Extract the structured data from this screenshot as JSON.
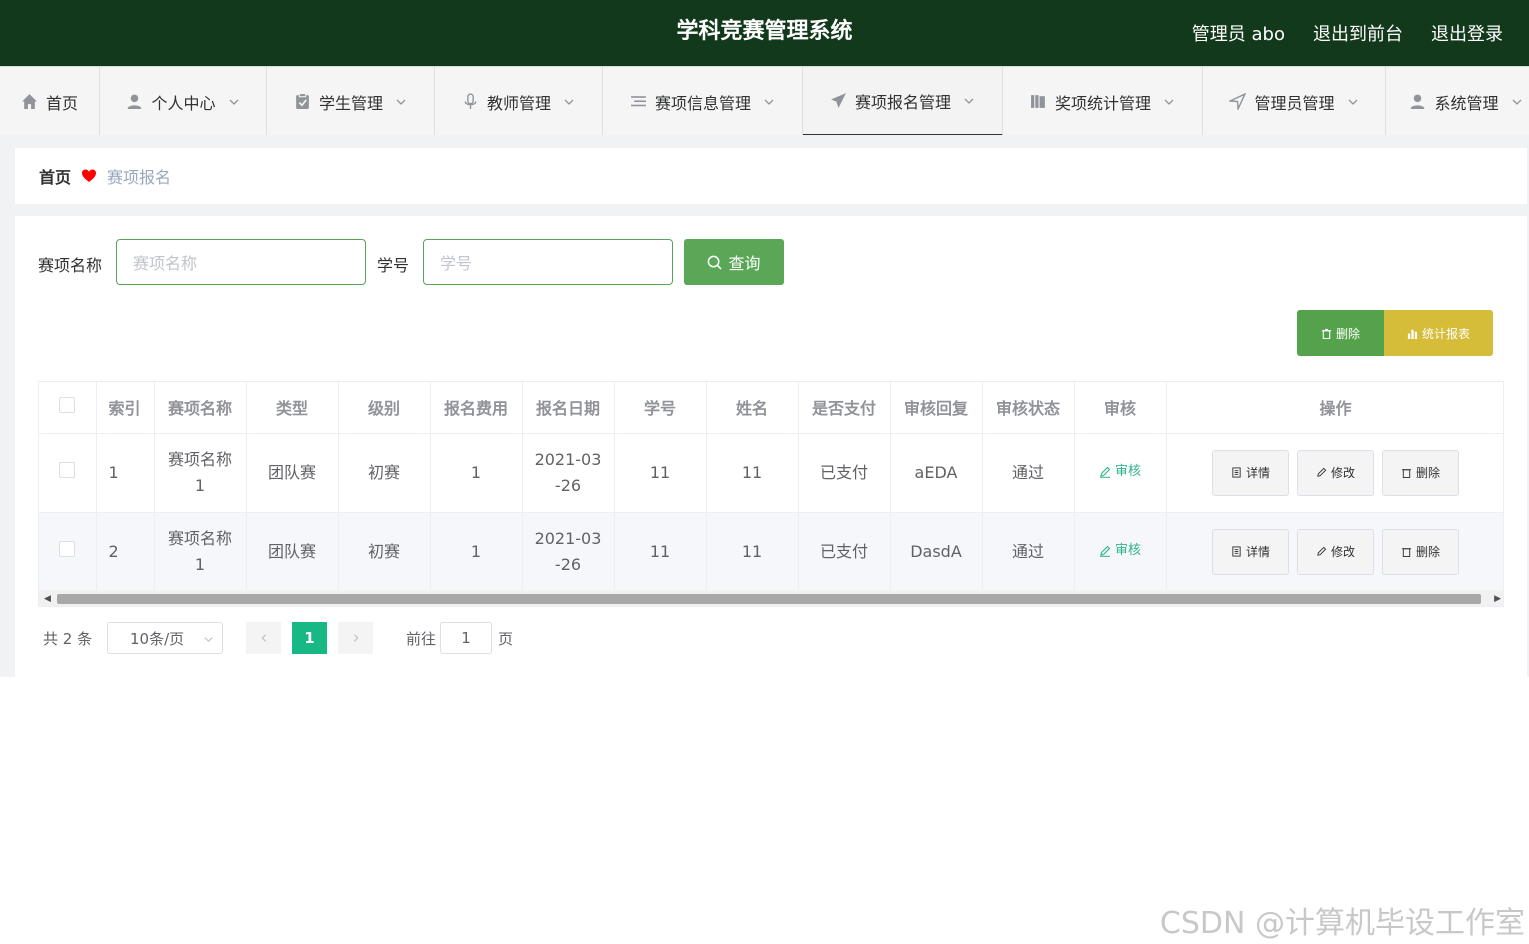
{
  "header": {
    "title": "学科竞赛管理系统",
    "user": "管理员 abo",
    "to_front": "退出到前台",
    "logout": "退出登录"
  },
  "nav": [
    {
      "label": "首页",
      "icon": "home-icon"
    },
    {
      "label": "个人中心",
      "icon": "user-icon"
    },
    {
      "label": "学生管理",
      "icon": "clipboard-icon"
    },
    {
      "label": "教师管理",
      "icon": "microphone-icon"
    },
    {
      "label": "赛项信息管理",
      "icon": "list-icon"
    },
    {
      "label": "赛项报名管理",
      "icon": "send-icon"
    },
    {
      "label": "奖项统计管理",
      "icon": "books-icon"
    },
    {
      "label": "管理员管理",
      "icon": "location-arrow-icon"
    },
    {
      "label": "系统管理",
      "icon": "user-icon"
    }
  ],
  "breadcrumb": {
    "home": "首页",
    "current": "赛项报名"
  },
  "search": {
    "name_label": "赛项名称",
    "name_placeholder": "赛项名称",
    "id_label": "学号",
    "id_placeholder": "学号",
    "query_button": "查询"
  },
  "actions": {
    "delete": "删除",
    "stats": "统计报表"
  },
  "table": {
    "columns": [
      "索引",
      "赛项名称",
      "类型",
      "级别",
      "报名费用",
      "报名日期",
      "学号",
      "姓名",
      "是否支付",
      "审核回复",
      "审核状态",
      "审核",
      "操作"
    ],
    "rows": [
      {
        "index": "1",
        "name_line1": "赛项名称",
        "name_line2": "1",
        "type": "团队赛",
        "level": "初赛",
        "fee": "1",
        "date_line1": "2021-03",
        "date_line2": "-26",
        "student_id": "11",
        "student_name": "11",
        "paid": "已支付",
        "reply": "aEDA",
        "status": "通过",
        "audit": "审核"
      },
      {
        "index": "2",
        "name_line1": "赛项名称",
        "name_line2": "1",
        "type": "团队赛",
        "level": "初赛",
        "fee": "1",
        "date_line1": "2021-03",
        "date_line2": "-26",
        "student_id": "11",
        "student_name": "11",
        "paid": "已支付",
        "reply": "DasdA",
        "status": "通过",
        "audit": "审核"
      }
    ],
    "op_detail": "详情",
    "op_edit": "修改",
    "op_delete": "删除"
  },
  "pagination": {
    "total": "共 2 条",
    "page_size": "10条/页",
    "current_page": "1",
    "goto_prefix": "前往",
    "goto_value": "1",
    "goto_suffix": "页"
  },
  "watermark": "CSDN @计算机毕设工作室",
  "colors": {
    "header_bg": "#12391b",
    "primary": "#5aa857",
    "warning": "#d5bd3a",
    "pager_active": "#18b884",
    "audit_link": "#2fb38a"
  }
}
